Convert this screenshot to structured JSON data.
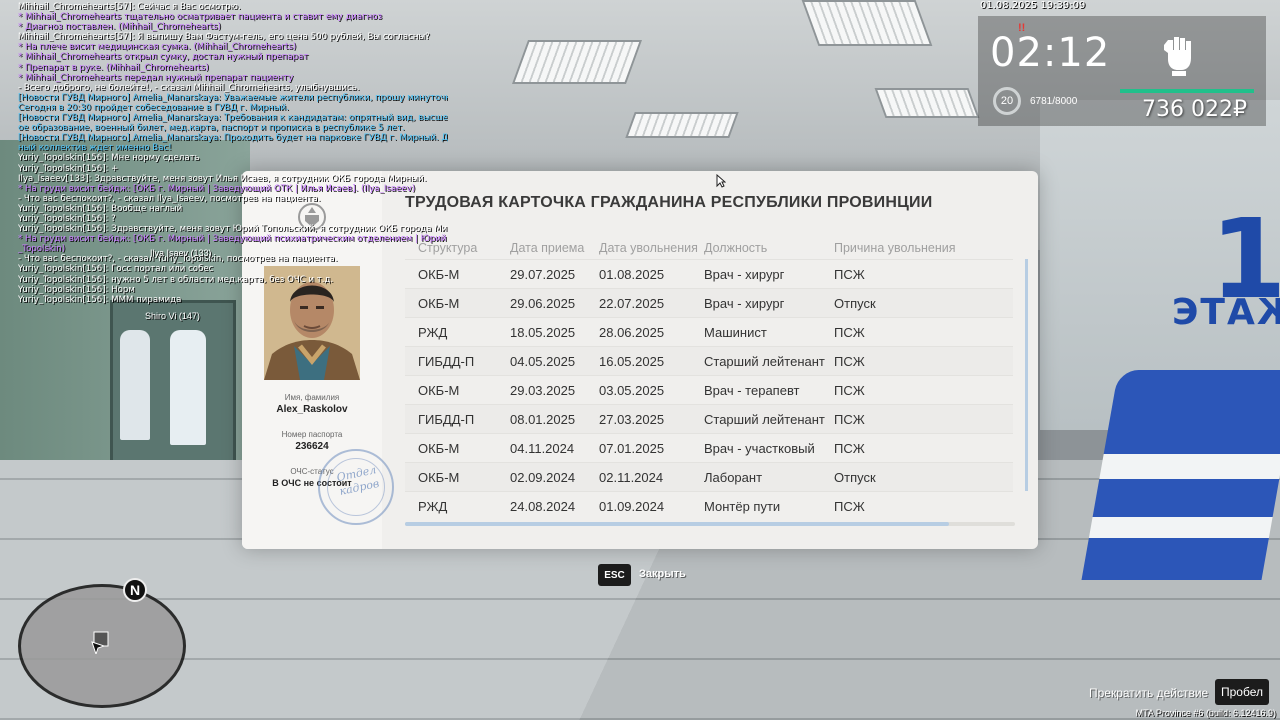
{
  "chat": [
    {
      "text": "Mihhail_Chromehearts[57]: Сейчас я Вас осмотрю.",
      "color": "#ffffff",
      "name_color": "#e040fb"
    },
    {
      "text": "* Mihhail_Chromehearts тщательно осматривает пациента и ставит ему диагноз",
      "color": "#c77dff"
    },
    {
      "text": "* Диагноз поставлен. (Mihhail_Chromehearts)",
      "color": "#c77dff"
    },
    {
      "text": "Mihhail_Chromehearts[57]: Я выпишу Вам Фастум-гель, его цена 500 рублей, Вы согласны?",
      "color": "#ffffff"
    },
    {
      "text": "* На плече висит медицинская сумка. (Mihhail_Chromehearts)",
      "color": "#c77dff"
    },
    {
      "text": "* Mihhail_Chromehearts открыл сумку, достал нужный препарат",
      "color": "#c77dff"
    },
    {
      "text": "* Препарат в руке. (Mihhail_Chromehearts)",
      "color": "#c77dff"
    },
    {
      "text": "* Mihhail_Chromehearts передал нужный препарат пациенту",
      "color": "#c77dff"
    },
    {
      "text": "- Всего доброго, не болейте!, - сказал Mihhail_Chromehearts, улыбнувшись.",
      "color": "#ffffff"
    },
    {
      "text": "[Новости ГУВД Мирного] Amelia_Manarskaya: Уважаемые жители республики, прошу минуточку внимания!",
      "color": "#4fc3f7"
    },
    {
      "text": "Сегодня в 20:30 пройдет собеседование в ГУВД г. Мирный.",
      "color": "#4fc3f7"
    },
    {
      "text": "[Новости ГУВД Мирного] Amelia_Manarskaya: Требования к кандидатам: опрятный вид, высшее юридическ",
      "color": "#4fc3f7"
    },
    {
      "text": "ое образование, военный билет, мед.карта, паспорт и прописка в республике 5 лет.",
      "color": "#4fc3f7"
    },
    {
      "text": "[Новости ГУВД Мирного] Amelia_Manarskaya: Проходить будет на парковке ГУВД г. Мирный. Дружелюб",
      "color": "#4fc3f7"
    },
    {
      "text": "ный коллектив ждет именно Вас!",
      "color": "#4fc3f7"
    },
    {
      "text": "Yuriy_Topolskin[156]: Мне норму сделать",
      "color": "#ffffff"
    },
    {
      "text": "Yuriy_Topolskin[156]: +",
      "color": "#ffffff"
    },
    {
      "text": "Ilya_Isaeev[133]: Здравствуйте, меня зовут Илья Исаев, я сотрудник ОКБ города Мирный.",
      "color": "#ffffff"
    },
    {
      "text": "* На груди висит бейдж: [ОКБ г. Мирный | Заведующий ОТК | Илья Исаев]. (Ilya_Isaeev)",
      "color": "#c77dff"
    },
    {
      "text": "- Что вас беспокоит?, - сказал Ilya_Isaeev, посмотрев на пациента.",
      "color": "#ffffff"
    },
    {
      "text": "Yuriy_Topolskin[156]: Вообще наглый",
      "color": "#ffffff"
    },
    {
      "text": "Yuriy_Topolskin[156]: ?",
      "color": "#ffffff"
    },
    {
      "text": "Yuriy_Topolskin[156]: Здравствуйте, меня зовут Юрий Топольский, я сотрудник ОКБ города Мирный.",
      "color": "#ffffff"
    },
    {
      "text": "* На груди висит бейдж: [ОКБ г. Мирный | Заведующий психиатрическим отделением | Юрий Топольский]. (Yuriy",
      "color": "#c77dff"
    },
    {
      "text": "_Topolskin)",
      "color": "#c77dff"
    },
    {
      "text": "- Что вас беспокоит?, - сказал Yuriy_Topolskin, посмотрев на пациента.",
      "color": "#ffffff"
    },
    {
      "text": "Yuriy_Topolskin[156]: Госс портал или собес",
      "color": "#ffffff"
    },
    {
      "text": "Yuriy_Topolskin[156]: нужно 5 лет в области мед.карта, без ОЧС и т.д.",
      "color": "#ffffff"
    },
    {
      "text": "Yuriy_Topolskin[156]: Норм",
      "color": "#ffffff"
    },
    {
      "text": "Yuriy_Topolskin[156]: МММ пирамида",
      "color": "#ffffff"
    }
  ],
  "nametags": {
    "tag1": "Ilya Isaev (133)",
    "tag2": "Shiro Vi (147)"
  },
  "hud": {
    "datetime": "01.08.2025 19:39:09",
    "timer": "02:12",
    "timer_mark": "!!",
    "level": "20",
    "xp": "6781/8000",
    "money": "736 022",
    "currency": "₽",
    "money_bar_color": "#21c08b"
  },
  "card": {
    "title": "ТРУДОВАЯ КАРТОЧКА ГРАЖДАНИНА РЕСПУБЛИКИ ПРОВИНЦИИ",
    "name_label": "Имя, фамилия",
    "name_value": "Alex_Raskolov",
    "passport_label": "Номер паспорта",
    "passport_value": "236624",
    "ochs_label": "ОЧС-статус",
    "ochs_value": "В ОЧС не состоит",
    "stamp_line1": "Отдел",
    "stamp_line2": "кадров",
    "columns": [
      "Структура",
      "Дата приема",
      "Дата увольнения",
      "Должность",
      "Причина увольнения"
    ],
    "rows": [
      [
        "ОКБ-М",
        "29.07.2025",
        "01.08.2025",
        "Врач - хирург",
        "ПСЖ"
      ],
      [
        "ОКБ-М",
        "29.06.2025",
        "22.07.2025",
        "Врач - хирург",
        "Отпуск"
      ],
      [
        "РЖД",
        "18.05.2025",
        "28.06.2025",
        "Машинист",
        "ПСЖ"
      ],
      [
        "ГИБДД-П",
        "04.05.2025",
        "16.05.2025",
        "Старший лейтенант",
        "ПСЖ"
      ],
      [
        "ОКБ-М",
        "29.03.2025",
        "03.05.2025",
        "Врач - терапевт",
        "ПСЖ"
      ],
      [
        "ГИБДД-П",
        "08.01.2025",
        "27.03.2025",
        "Старший лейтенант",
        "ПСЖ"
      ],
      [
        "ОКБ-М",
        "04.11.2024",
        "07.01.2025",
        "Врач - участковый",
        "ПСЖ"
      ],
      [
        "ОКБ-М",
        "02.09.2024",
        "02.11.2024",
        "Лаборант",
        "Отпуск"
      ],
      [
        "РЖД",
        "24.08.2024",
        "01.09.2024",
        "Монтёр пути",
        "ПСЖ"
      ]
    ]
  },
  "close": {
    "key": "ESC",
    "label": "Закрыть"
  },
  "bottom": {
    "abort_label": "Прекратить действие",
    "space_key": "Пробел",
    "build": "MTA Province #6 (build: 6.12416.9)"
  },
  "minimap": {
    "north": "N"
  },
  "scene": {
    "floor_number": "1",
    "floor_word": "ЭТАЖ"
  }
}
